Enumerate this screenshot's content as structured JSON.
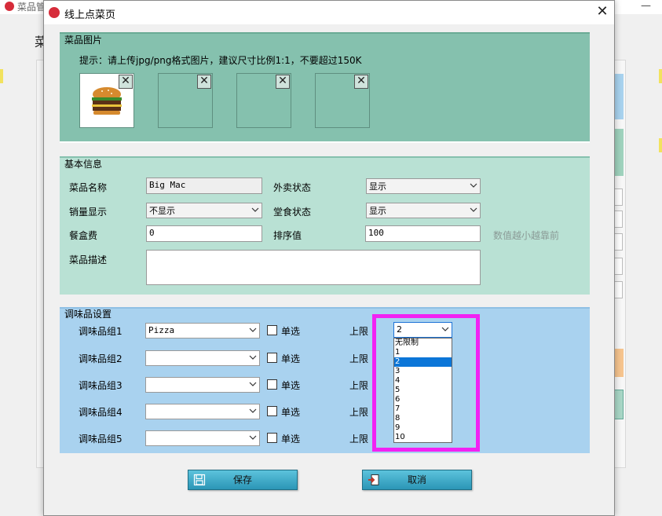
{
  "background_app": {
    "title": "菜品管",
    "label": "菜",
    "minimize_glyph": "—"
  },
  "dialog": {
    "title": "线上点菜页",
    "close_glyph": "✕"
  },
  "image_panel": {
    "legend": "菜品图片",
    "hint": "提示：请上传jpg/png格式图片，建议尺寸比例1:1，不要超过150K",
    "remove_glyph": "✕",
    "slots": [
      {
        "has_image": true,
        "icon": "burger-image"
      },
      {
        "has_image": false
      },
      {
        "has_image": false
      },
      {
        "has_image": false
      }
    ]
  },
  "basic_info": {
    "legend": "基本信息",
    "name_label": "菜品名称",
    "name_value": "Big Mac",
    "takeout_label": "外卖状态",
    "takeout_value": "显示",
    "sales_label": "销量显示",
    "sales_value": "不显示",
    "dinein_label": "堂食状态",
    "dinein_value": "显示",
    "box_fee_label": "餐盒费",
    "box_fee_value": "0",
    "sort_label": "排序值",
    "sort_value": "100",
    "sort_hint": "数值越小越靠前",
    "desc_label": "菜品描述",
    "desc_value": ""
  },
  "condiment": {
    "legend": "调味品设置",
    "single_label": "单选",
    "limit_label": "上限",
    "groups": [
      {
        "label": "调味品组1",
        "value": "Pizza"
      },
      {
        "label": "调味品组2",
        "value": ""
      },
      {
        "label": "调味品组3",
        "value": ""
      },
      {
        "label": "调味品组4",
        "value": ""
      },
      {
        "label": "调味品组5",
        "value": ""
      }
    ]
  },
  "limit_dropdown": {
    "selected": "2",
    "options": [
      "无限制",
      "1",
      "2",
      "3",
      "4",
      "5",
      "6",
      "7",
      "8",
      "9",
      "10"
    ],
    "highlighted_index": 2,
    "highlight_color": "#f122f3"
  },
  "buttons": {
    "save": "保存",
    "cancel": "取消"
  },
  "colors": {
    "image_panel": "#85c1ae",
    "info_panel": "#b9e1d4",
    "condiment_panel": "#a9d2ef",
    "button": "#2b95b6",
    "selection": "#0b76d8"
  }
}
